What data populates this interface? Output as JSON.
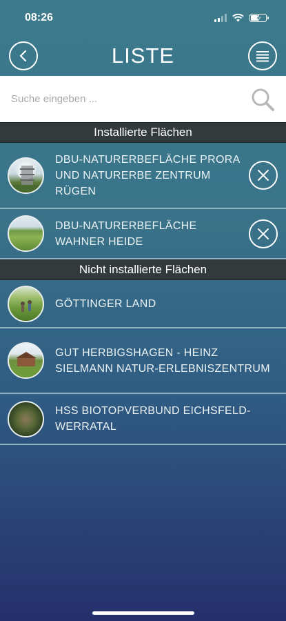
{
  "status_bar": {
    "time": "08:26",
    "icons": [
      "signal-icon",
      "wifi-icon",
      "battery-charging-icon"
    ]
  },
  "header": {
    "title": "LISTE",
    "back_icon": "chevron-left-icon",
    "menu_icon": "list-menu-icon"
  },
  "search": {
    "placeholder": "Suche eingeben ...",
    "value": "",
    "icon": "search-icon"
  },
  "sections": {
    "installed": {
      "title": "Installierte Flächen",
      "items": [
        {
          "label": "DBU-NATURERBEFLÄCHE PRORA UND NATURERBE ZENTRUM RÜGEN",
          "thumb": "tower-photo",
          "action_icon": "close-icon"
        },
        {
          "label": "DBU-NATURERBEFLÄCHE WAHNER HEIDE",
          "thumb": "meadow-photo",
          "action_icon": "close-icon"
        }
      ]
    },
    "not_installed": {
      "title": "Nicht installierte Flächen",
      "items": [
        {
          "label": "GÖTTINGER LAND",
          "thumb": "field-photo"
        },
        {
          "label": "GUT HERBIGSHAGEN - HEINZ SIELMANN NATUR-ERLEBNISZENTRUM",
          "thumb": "house-photo"
        },
        {
          "label": "HSS BIOTOPVERBUND EICHSFELD-WERRATAL",
          "thumb": "forest-photo"
        }
      ]
    }
  },
  "colors": {
    "background_top": "#3c7a8c",
    "background_bottom": "#262f6b",
    "section_header": "#333a3c",
    "divider": "#8fb3c0"
  }
}
